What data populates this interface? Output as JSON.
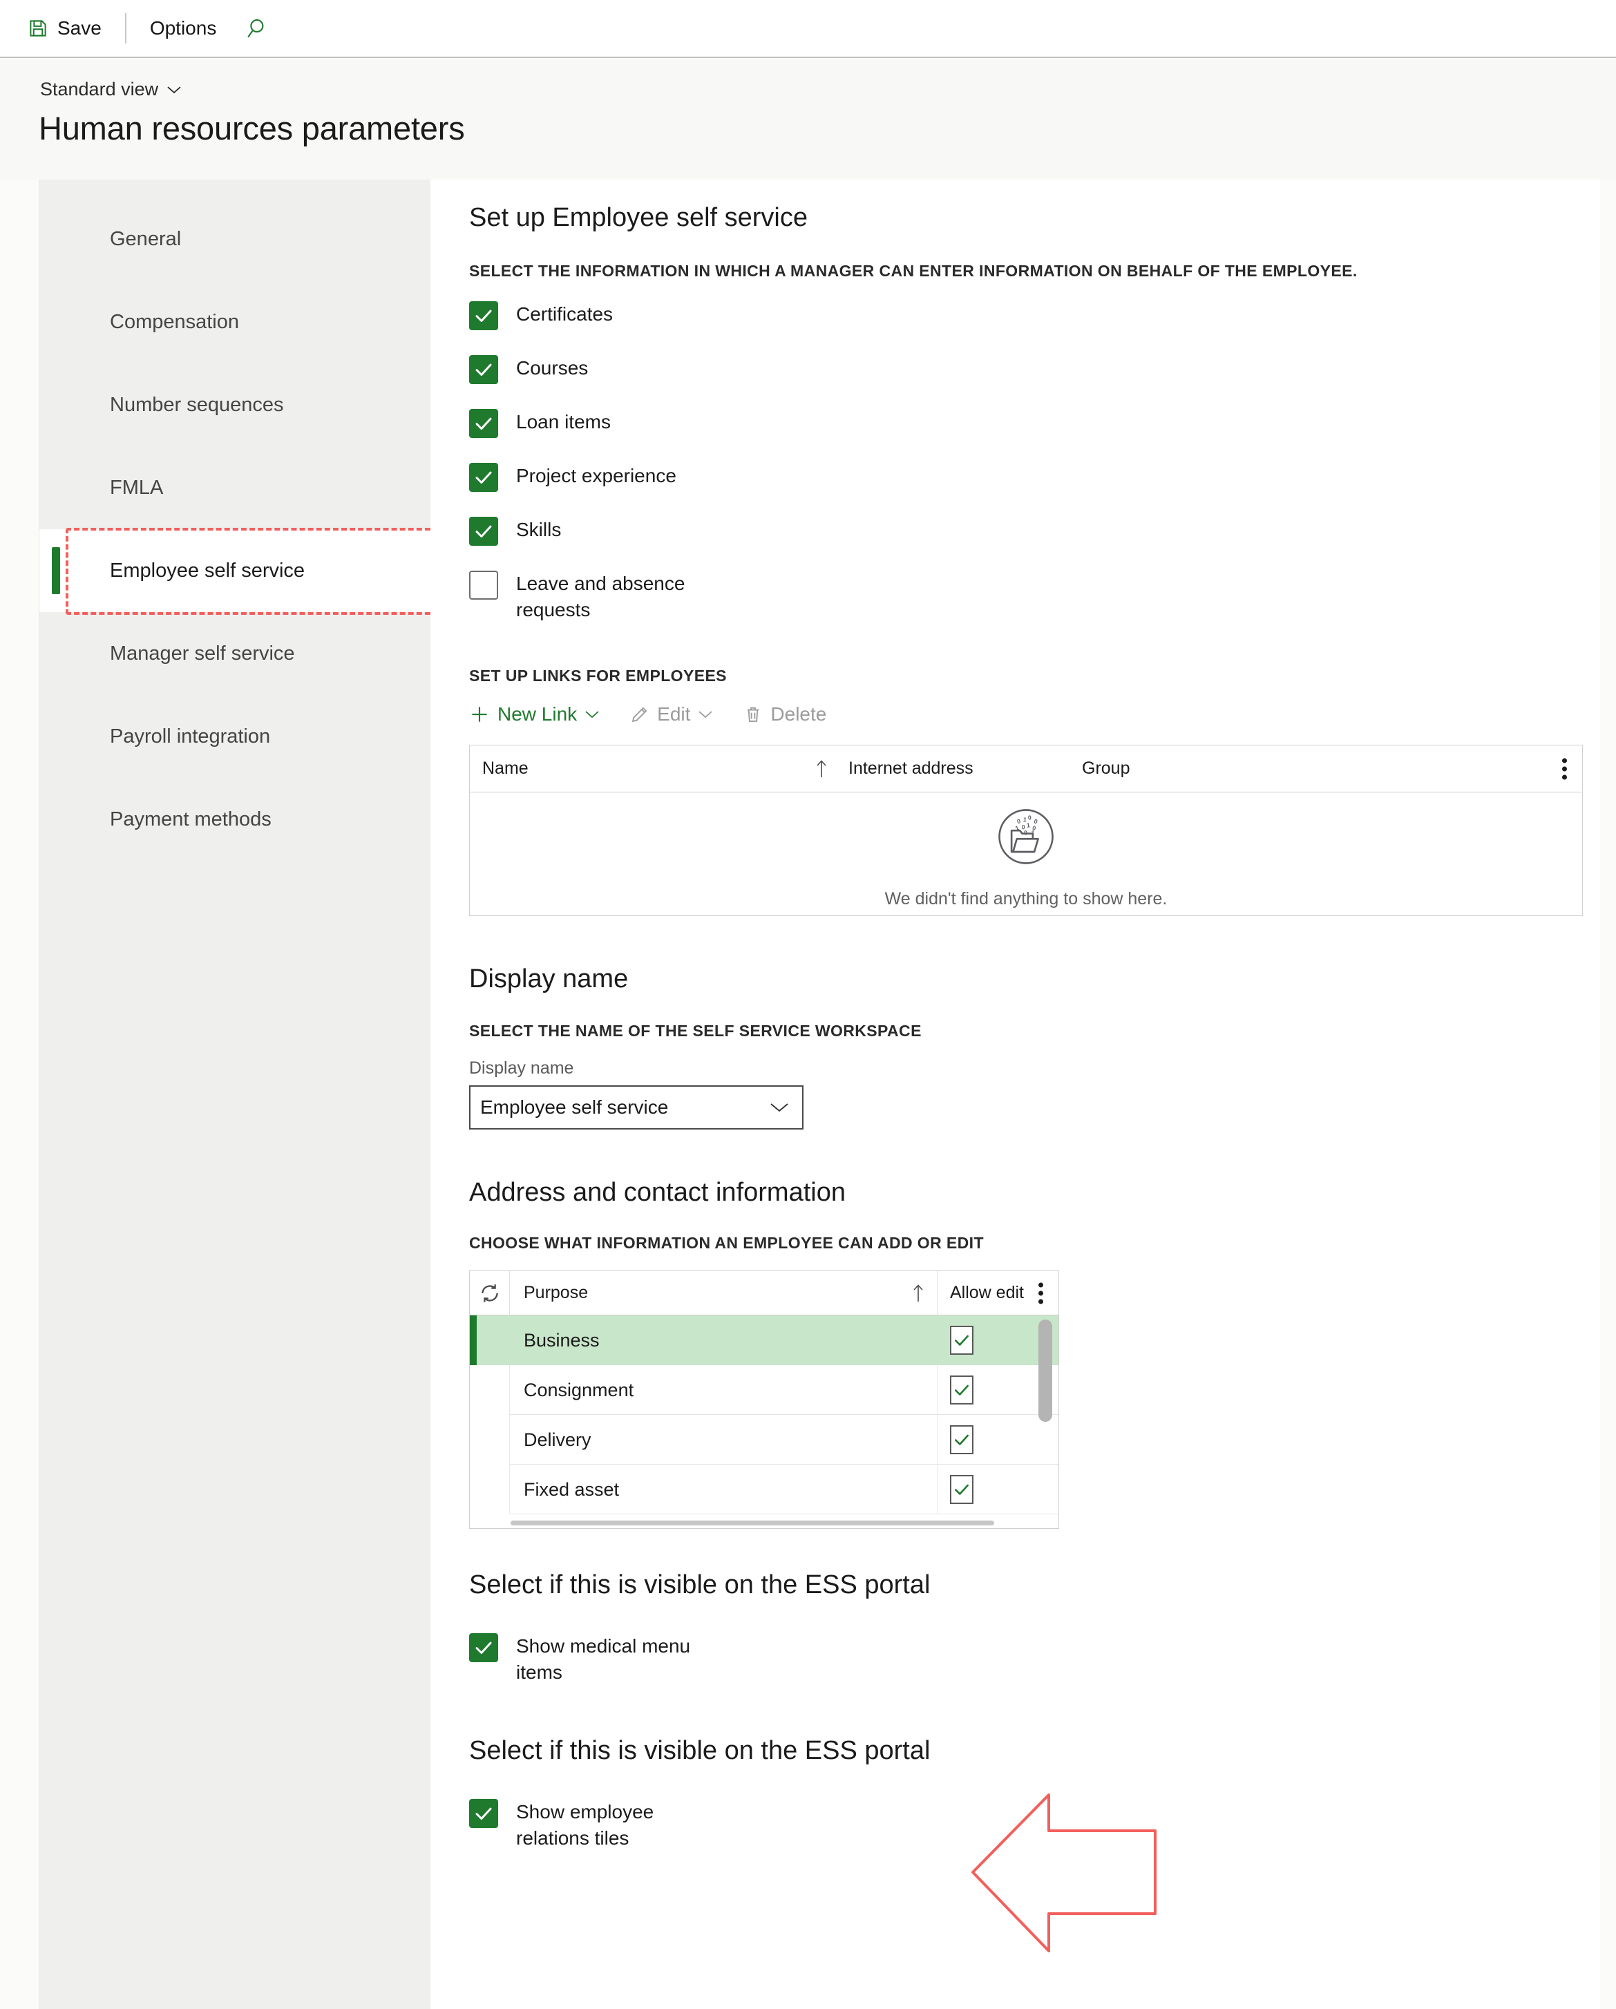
{
  "command_bar": {
    "save_label": "Save",
    "options_label": "Options",
    "save_icon": "save-icon",
    "search_icon": "search-icon"
  },
  "page_header": {
    "view_selector_label": "Standard view",
    "view_selector_icon": "chevron-down-icon",
    "title": "Human resources parameters"
  },
  "sidebar": {
    "items": [
      {
        "label": "General",
        "active": false
      },
      {
        "label": "Compensation",
        "active": false
      },
      {
        "label": "Number sequences",
        "active": false
      },
      {
        "label": "FMLA",
        "active": false
      },
      {
        "label": "Employee self service",
        "active": true
      },
      {
        "label": "Manager self service",
        "active": false
      },
      {
        "label": "Payroll integration",
        "active": false
      },
      {
        "label": "Payment methods",
        "active": false
      }
    ]
  },
  "main": {
    "ess_section": {
      "title": "Set up Employee self service",
      "subtitle": "Select the information in which a manager can enter information on behalf of the employee.",
      "options": [
        {
          "label": "Certificates",
          "checked": true
        },
        {
          "label": "Courses",
          "checked": true
        },
        {
          "label": "Loan items",
          "checked": true
        },
        {
          "label": "Project experience",
          "checked": true
        },
        {
          "label": "Skills",
          "checked": true
        },
        {
          "label": "Leave and absence requests",
          "checked": false
        }
      ]
    },
    "links_section": {
      "subtitle": "Set up links for employees",
      "toolbar": [
        {
          "label": "New Link",
          "icon": "plus-icon",
          "enabled": true,
          "has_caret": true
        },
        {
          "label": "Edit",
          "icon": "pencil-icon",
          "enabled": false,
          "has_caret": true
        },
        {
          "label": "Delete",
          "icon": "trash-icon",
          "enabled": false,
          "has_caret": false
        }
      ],
      "columns": [
        "Name",
        "Internet address",
        "Group"
      ],
      "sort_column": "Name",
      "sort_direction": "ascending",
      "rows": [],
      "empty_message": "We didn't find anything to show here.",
      "empty_icon": "empty-folder-binary-icon",
      "overflow_icon": "more-vertical-icon"
    },
    "display_name_section": {
      "title": "Display name",
      "subtitle": "Select the name of the self service workspace",
      "field_label": "Display name",
      "field_value": "Employee self service",
      "field_icon": "chevron-down-icon"
    },
    "address_section": {
      "title": "Address and contact information",
      "subtitle": "Choose what information an employee can add or edit",
      "refresh_icon": "refresh-icon",
      "overflow_icon": "more-vertical-icon",
      "columns": [
        "Purpose",
        "Allow edit"
      ],
      "sort_column": "Purpose",
      "sort_direction": "ascending",
      "rows": [
        {
          "purpose": "Business",
          "allow_edit": true,
          "selected": true
        },
        {
          "purpose": "Consignment",
          "allow_edit": true,
          "selected": false
        },
        {
          "purpose": "Delivery",
          "allow_edit": true,
          "selected": false
        },
        {
          "purpose": "Fixed asset",
          "allow_edit": true,
          "selected": false
        }
      ]
    },
    "ess_portal_section_1": {
      "title": "Select if this is visible on the ESS portal",
      "options": [
        {
          "label": "Show medical menu items",
          "checked": true
        }
      ]
    },
    "ess_portal_section_2": {
      "title": "Select if this is visible on the ESS portal",
      "options": [
        {
          "label": "Show employee relations tiles",
          "checked": true
        }
      ]
    }
  },
  "annotations": {
    "highlight_target": "Employee self service",
    "arrow_target": "Select if this is visible on the ESS portal",
    "color": "#f25f5c",
    "arrow_icon": "left-arrow-annotation"
  },
  "colors": {
    "accent_green": "#1f7a2e",
    "selected_row": "#c8e6c9",
    "sidebar_bg": "#efefee",
    "header_bg": "#f8f8f7",
    "annotation_red": "#f25f5c"
  }
}
